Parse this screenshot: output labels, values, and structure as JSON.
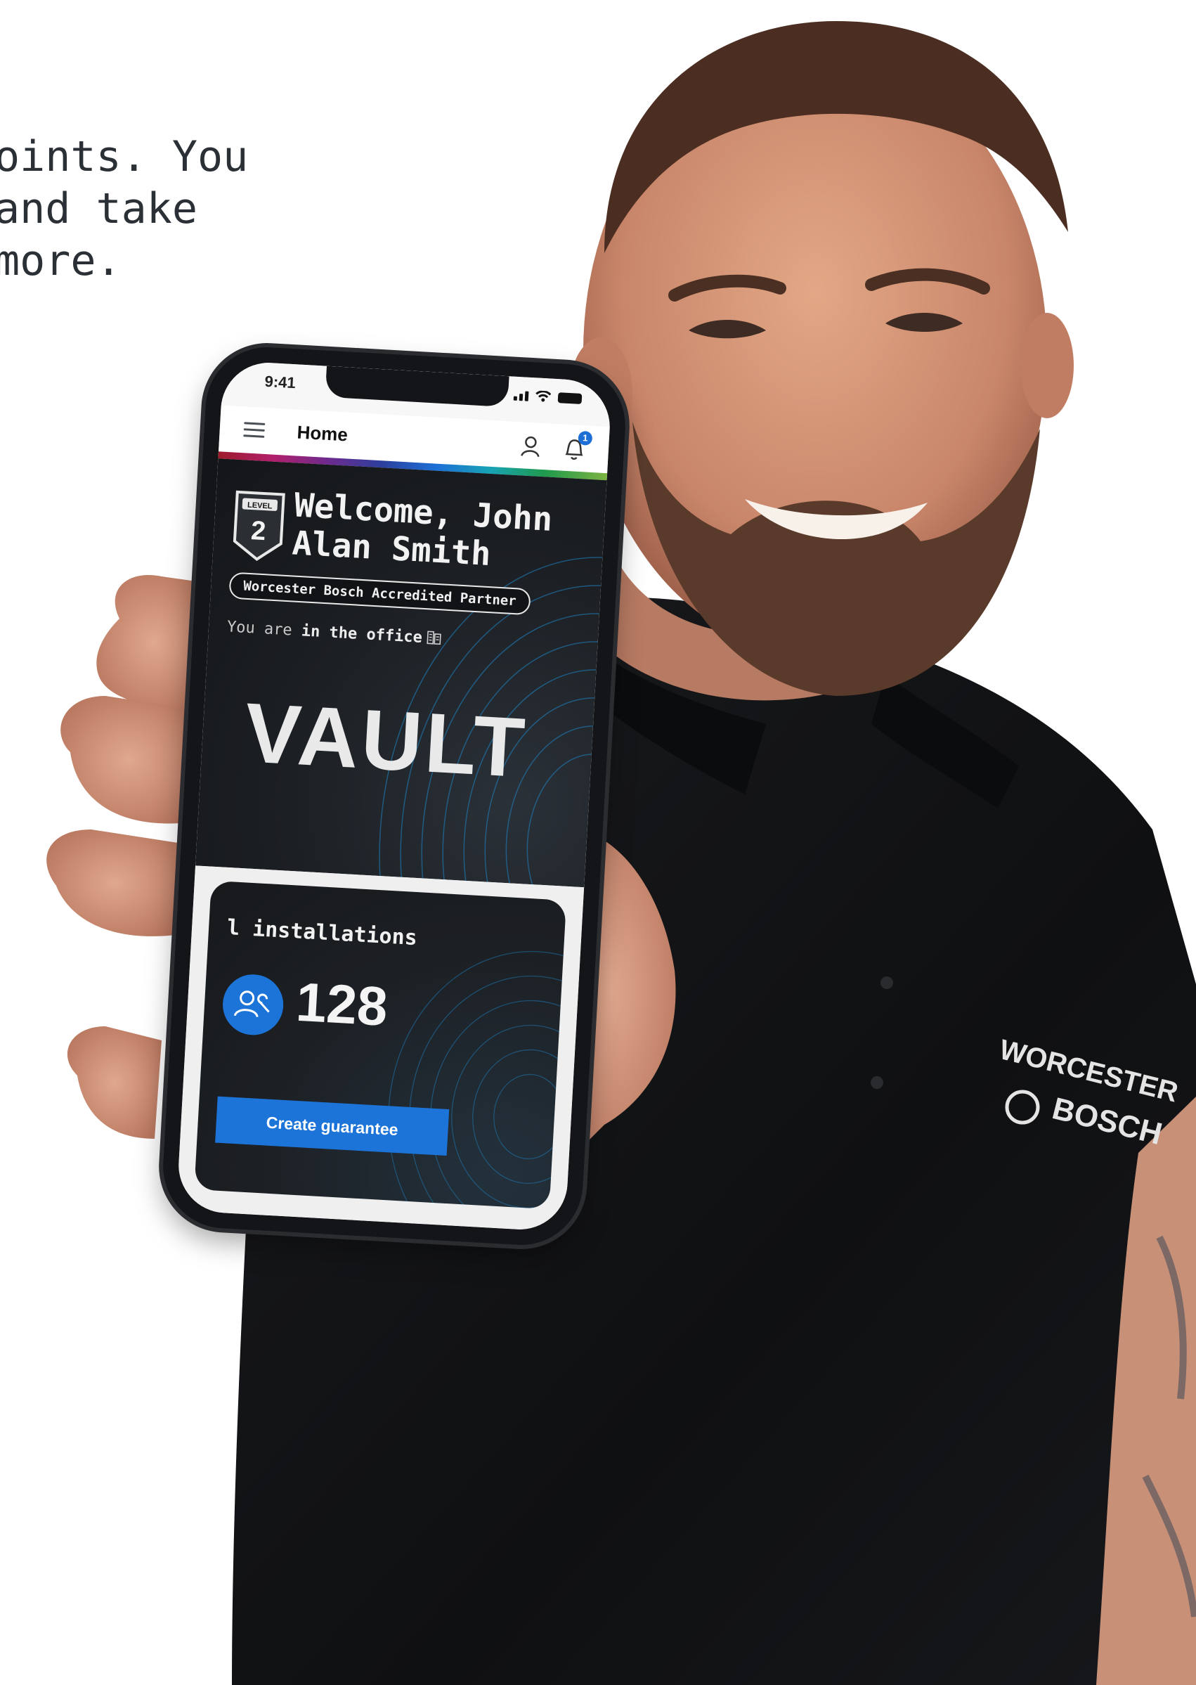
{
  "hero": {
    "lines": [
      "oints. You",
      "and take",
      "more."
    ]
  },
  "phone": {
    "status": {
      "time": "9:41"
    },
    "header": {
      "title": "Home",
      "notification_count": "1"
    },
    "profile": {
      "level_label": "LEVEL",
      "level_number": "2",
      "welcome": "Welcome, John Alan Smith",
      "partner_status": "Worcester Bosch Accredited Partner",
      "location_prefix": "You are ",
      "location_value": "in the office"
    },
    "brand": "VAULT",
    "installations": {
      "title": "l installations",
      "count": "128",
      "button_label": "Create guarantee"
    }
  },
  "shirt": {
    "logo_1": "WORCESTER",
    "logo_2": "BOSCH"
  },
  "colors": {
    "accent_blue": "#1d74d8",
    "panel_dark": "#1b1e22",
    "shirt": "#111214"
  }
}
